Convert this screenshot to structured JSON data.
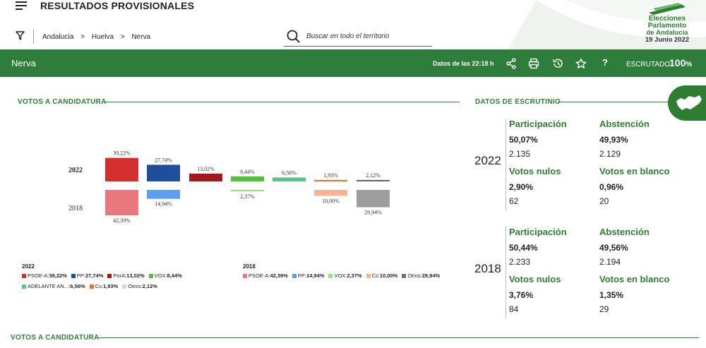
{
  "header": {
    "title": "RESULTADOS PROVISIONALES",
    "breadcrumb": [
      "Andalucía",
      ">",
      "Huelva",
      ">",
      "Nerva"
    ],
    "search_placeholder": "Buscar en todo el territorio",
    "logo": {
      "line1": "Elecciones",
      "line2": "Parlamento",
      "line3": "de Andalucía",
      "line4": "19 Junio 2022"
    }
  },
  "bar": {
    "place": "Nerva",
    "updated": "Datos de las 22:18 h",
    "escrutado_label": "ESCRUTADO",
    "escrutado_value": "100",
    "escrutado_unit": "%",
    "help": "?"
  },
  "sections": {
    "votes": "VOTOS A CANDIDATURA",
    "scrutiny": "DATOS DE ESCRUTINIO",
    "votes2": "VOTOS A CANDIDATURA"
  },
  "chart_data": {
    "type": "bar",
    "row_labels": [
      "2022",
      "2018"
    ],
    "series_2022": [
      {
        "party": "PSOE-A",
        "value": 39.22,
        "label": "39,22%",
        "color": "#d32f2f"
      },
      {
        "party": "PP",
        "value": 27.74,
        "label": "27,74%",
        "color": "#1f4f9c"
      },
      {
        "party": "PorA",
        "value": 13.02,
        "label": "13,02%",
        "color": "#a31919"
      },
      {
        "party": "VOX",
        "value": 8.44,
        "label": "8,44%",
        "color": "#54c03c"
      },
      {
        "party": "ADELANTE AN...",
        "value": 6.56,
        "label": "6,56%",
        "color": "#5ec08a"
      },
      {
        "party": "Cs",
        "value": 1.93,
        "label": "1,93%",
        "color": "#ef6c2d"
      },
      {
        "party": "Otros",
        "value": 2.12,
        "label": "2,12%",
        "color": "#616161"
      }
    ],
    "series_2018": [
      {
        "party": "PSOE-A",
        "value": 42.39,
        "label": "42,39%",
        "color": "#e8787e"
      },
      {
        "party": "PP",
        "value": 14.94,
        "label": "14,94%",
        "color": "#5aa0ee"
      },
      {
        "party": "",
        "value": null,
        "label": "",
        "color": ""
      },
      {
        "party": "VOX",
        "value": 2.37,
        "label": "2,37%",
        "color": "#8de877"
      },
      {
        "party": "",
        "value": null,
        "label": "",
        "color": ""
      },
      {
        "party": "Cs",
        "value": 10.0,
        "label": "10,00%",
        "color": "#f6b693"
      },
      {
        "party": "Otros",
        "value": 28.94,
        "label": "28,94%",
        "color": "#9e9e9e"
      }
    ]
  },
  "legend": {
    "year_2022": "2022",
    "items_2022_row1": [
      {
        "name": "PSOE-A:",
        "val": "39,22%",
        "color": "#d32f2f"
      },
      {
        "name": "PP:",
        "val": "27,74%",
        "color": "#1f4f9c"
      },
      {
        "name": "PorA:",
        "val": "13,02%",
        "color": "#a31919"
      },
      {
        "name": "VOX:",
        "val": "8,44%",
        "color": "#54c03c"
      }
    ],
    "items_2022_row2": [
      {
        "name": "ADELANTE AN...",
        "val": ":6,56%",
        "color": "#5ec08a"
      },
      {
        "name": "Cs:",
        "val": "1,93%",
        "color": "#ef6c2d"
      },
      {
        "name": "Otros:",
        "val": "2,12%",
        "color": "#d6d6d6"
      }
    ],
    "year_2018": "2018",
    "items_2018": [
      {
        "name": "PSOE-A:",
        "val": "42,39%",
        "color": "#e8787e"
      },
      {
        "name": "PP:",
        "val": "14,94%",
        "color": "#5aa0ee"
      },
      {
        "name": "VOX:",
        "val": "2,37%",
        "color": "#8de877"
      },
      {
        "name": "Cs:",
        "val": "10,00%",
        "color": "#f6b693"
      },
      {
        "name": "Otros:",
        "val": "28,94%",
        "color": "#707070"
      }
    ]
  },
  "scrutiny": [
    {
      "year": "2022",
      "participacion_label": "Participación",
      "participacion_pct": "50,07%",
      "participacion_n": "2.135",
      "abstencion_label": "Abstención",
      "abstencion_pct": "49,93%",
      "abstencion_n": "2.129",
      "nulos_label": "Votos nulos",
      "nulos_pct": "2,90%",
      "nulos_n": "62",
      "blanco_label": "Votos en blanco",
      "blanco_pct": "0,96%",
      "blanco_n": "20"
    },
    {
      "year": "2018",
      "participacion_label": "Participación",
      "participacion_pct": "50,44%",
      "participacion_n": "2.233",
      "abstencion_label": "Abstención",
      "abstencion_pct": "49,56%",
      "abstencion_n": "2.194",
      "nulos_label": "Votos nulos",
      "nulos_pct": "3,76%",
      "nulos_n": "84",
      "blanco_label": "Votos en blanco",
      "blanco_pct": "1,35%",
      "blanco_n": "29"
    }
  ]
}
